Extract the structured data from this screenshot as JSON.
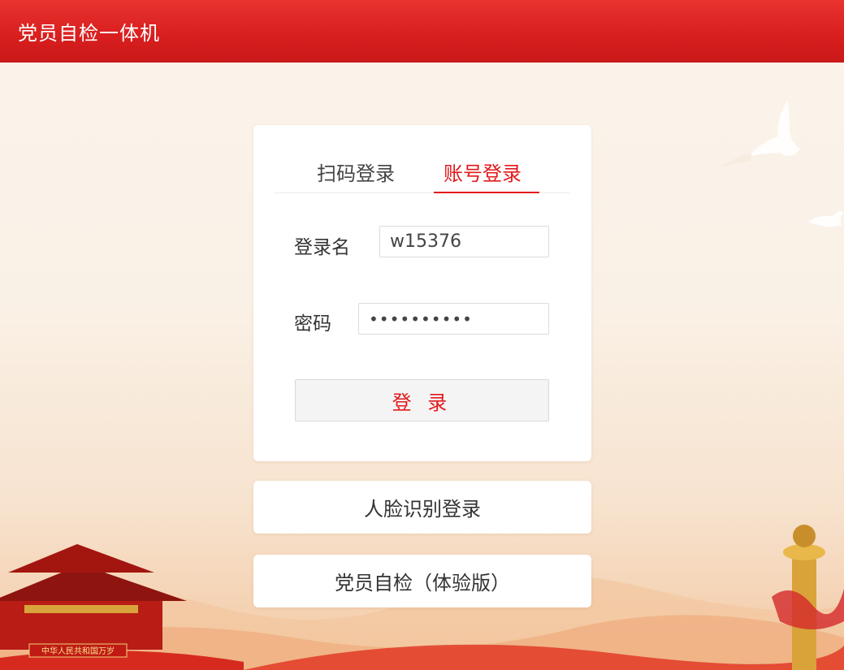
{
  "header": {
    "title": "党员自检一体机"
  },
  "tabs": {
    "qr": "扫码登录",
    "account": "账号登录"
  },
  "form": {
    "username_label": "登录名",
    "username_value": "w15376",
    "password_label": "密码",
    "password_value": "••••••••••",
    "submit_label": "登 录"
  },
  "buttons": {
    "face_login": "人脸识别登录",
    "demo": "党员自检（体验版）"
  },
  "decor": {
    "banner_text": "中华人民共和国万岁",
    "icons": [
      "dove-icon",
      "dove-icon",
      "tiananmen-icon",
      "huabiao-icon"
    ]
  },
  "colors": {
    "header": "#d81e1e",
    "accent": "#e3191b"
  }
}
